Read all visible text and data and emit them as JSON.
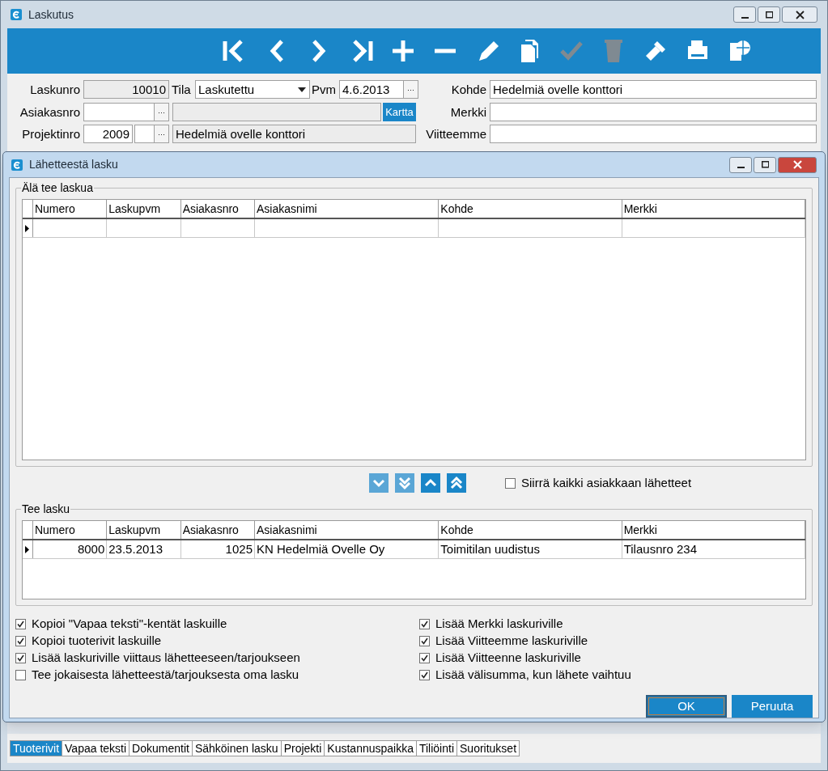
{
  "window": {
    "title": "Laskutus"
  },
  "toolbar": [
    {
      "kind": "first",
      "disabled": false
    },
    {
      "kind": "prev",
      "disabled": false
    },
    {
      "kind": "next",
      "disabled": false
    },
    {
      "kind": "last",
      "disabled": false
    },
    {
      "kind": "add",
      "disabled": false
    },
    {
      "kind": "remove",
      "disabled": false
    },
    {
      "kind": "edit",
      "disabled": false
    },
    {
      "kind": "copy",
      "disabled": false
    },
    {
      "kind": "save",
      "disabled": true
    },
    {
      "kind": "delete",
      "disabled": true
    },
    {
      "kind": "flashlight",
      "disabled": false
    },
    {
      "kind": "print",
      "disabled": false
    },
    {
      "kind": "globe",
      "disabled": false
    }
  ],
  "form": {
    "laskunro": {
      "label": "Laskunro",
      "value": "10010"
    },
    "tila": {
      "label": "Tila",
      "value": "Laskutettu"
    },
    "pvm": {
      "label": "Pvm",
      "value": "4.6.2013"
    },
    "asiakasnro": {
      "label": "Asiakasnro"
    },
    "kartta": "Kartta",
    "projektinro": {
      "label": "Projektinro",
      "value": "2009",
      "name": "Hedelmiä ovelle konttori"
    },
    "kohde": {
      "label": "Kohde",
      "value": "Hedelmiä ovelle konttori"
    },
    "merkki": {
      "label": "Merkki"
    },
    "viitteemme": {
      "label": "Viitteemme"
    },
    "ellipsis": "···"
  },
  "dialog": {
    "title": "Lähetteestä lasku",
    "excluded": {
      "title": "Älä tee laskua",
      "columns": [
        "Numero",
        "Laskupvm",
        "Asiakasnro",
        "Asiakasnimi",
        "Kohde",
        "Merkki"
      ]
    },
    "move_buttons": [
      {
        "kind": "down",
        "disabled": true
      },
      {
        "kind": "all-down",
        "disabled": true
      },
      {
        "kind": "up",
        "disabled": false
      },
      {
        "kind": "all-up",
        "disabled": false
      }
    ],
    "move_all": {
      "label": "Siirrä kaikki asiakkaan lähetteet",
      "checked": false
    },
    "included": {
      "title": "Tee lasku",
      "columns": [
        "Numero",
        "Laskupvm",
        "Asiakasnro",
        "Asiakasnimi",
        "Kohde",
        "Merkki"
      ],
      "rows": [
        {
          "current": true,
          "cells": [
            "8000",
            "23.5.2013",
            "1025",
            "KN Hedelmiä Ovelle Oy",
            "Toimitilan uudistus",
            "Tilausnro 234"
          ]
        }
      ]
    },
    "options_left": [
      {
        "label": "Kopioi \"Vapaa teksti\"-kentät laskuille",
        "checked": true
      },
      {
        "label": "Kopioi tuoterivit laskuille",
        "checked": true
      },
      {
        "label": "Lisää laskuriville viittaus lähetteeseen/tarjoukseen",
        "checked": true
      },
      {
        "label": "Tee jokaisesta lähetteestä/tarjouksesta oma lasku",
        "checked": false
      }
    ],
    "options_right": [
      {
        "label": "Lisää Merkki laskuriville",
        "checked": true
      },
      {
        "label": "Lisää Viitteemme laskuriville",
        "checked": true
      },
      {
        "label": "Lisää Viitteenne laskuriville",
        "checked": true
      },
      {
        "label": "Lisää välisumma, kun lähete vaihtuu",
        "checked": true
      }
    ],
    "buttons": [
      {
        "label": "OK",
        "default": true
      },
      {
        "label": "Peruuta",
        "default": false
      }
    ]
  },
  "bottom_tabs": [
    {
      "label": "Tuoterivit",
      "selected": true
    },
    {
      "label": "Vapaa teksti",
      "selected": false
    },
    {
      "label": "Dokumentit",
      "selected": false
    },
    {
      "label": "Sähköinen lasku",
      "selected": false
    },
    {
      "label": "Projekti",
      "selected": false
    },
    {
      "label": "Kustannuspaikka",
      "selected": false
    },
    {
      "label": "Tiliöinti",
      "selected": false
    },
    {
      "label": "Suoritukset",
      "selected": false
    }
  ]
}
